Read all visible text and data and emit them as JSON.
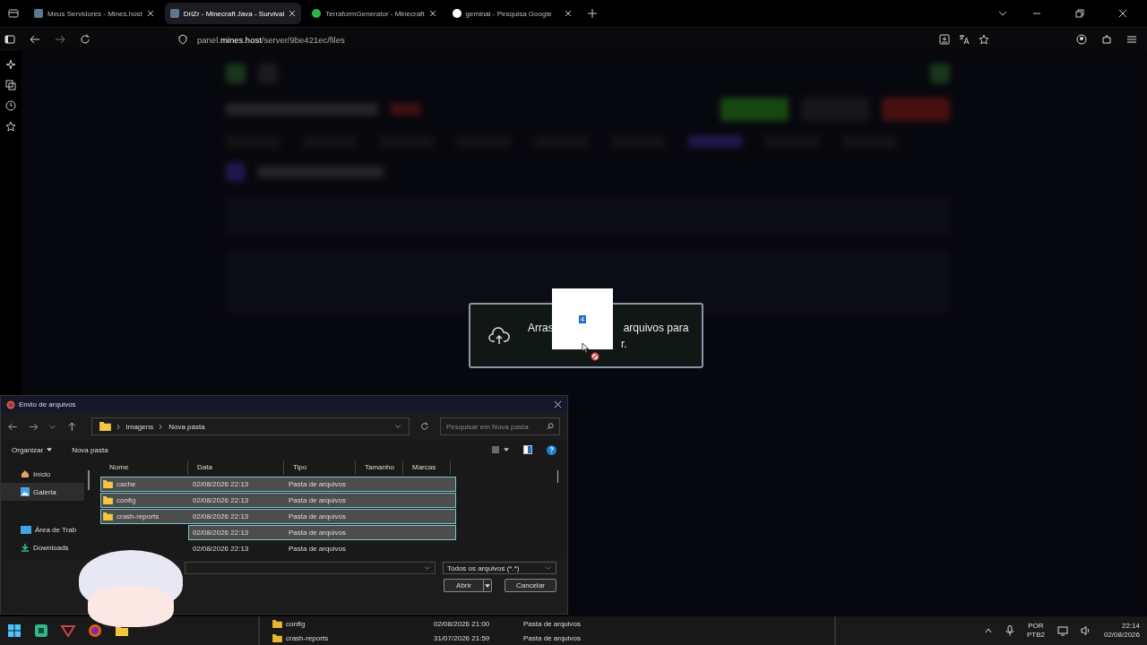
{
  "browser": {
    "tabs": [
      {
        "title": "Meus Servidores - Mines.host",
        "selected": false,
        "kind": "server"
      },
      {
        "title": "DriZr - Minecraft Java - Survival",
        "selected": true,
        "kind": "server"
      },
      {
        "title": "TerraformGenerator - Minecraft",
        "selected": false,
        "kind": "plugin"
      },
      {
        "title": "geminai - Pesquisa Google",
        "selected": false,
        "kind": "google"
      }
    ],
    "url": {
      "prefix": "panel.",
      "domain": "mines.host",
      "path": "/server/9be421ec/files"
    }
  },
  "drop_overlay": {
    "text_before": "Arras",
    "text_after": "arquivos para",
    "line_two": "r.",
    "drag_count": "4"
  },
  "dialog": {
    "title": "Envio de arquivos",
    "breadcrumb": [
      "Imagens",
      "Nova pasta"
    ],
    "search": {
      "placeholder": "Pesquisar em Nova pasta"
    },
    "toolbar": [
      "Organizar",
      "Nova pasta"
    ],
    "nav": [
      {
        "label": "Início",
        "selected": false,
        "kind": "home"
      },
      {
        "label": "Galeria",
        "selected": true,
        "kind": "gallery"
      },
      {
        "label": "Área de Trab",
        "selected": false,
        "kind": "desktop"
      },
      {
        "label": "Downloads",
        "selected": false,
        "kind": "download"
      }
    ],
    "columns": [
      "Nome",
      "Data",
      "Tipo",
      "Tamanho",
      "Marcas"
    ],
    "rows": [
      {
        "name": "cache",
        "date": "02/08/2026 22:13",
        "type": "Pasta de arquivos",
        "selected": true
      },
      {
        "name": "config",
        "date": "02/08/2026 22:13",
        "type": "Pasta de arquivos",
        "selected": true
      },
      {
        "name": "crash-reports",
        "date": "02/08/2026 22:13",
        "type": "Pasta de arquivos",
        "selected": true
      },
      {
        "date": "02/08/2026 22:13",
        "type": "Pasta de arquivos",
        "selected": true
      },
      {
        "date": "02/08/2026 22:13",
        "type": "Pasta de arquivos",
        "selected": false
      }
    ],
    "filter": "Todos os arquivos (*.*)",
    "buttons": [
      "Abrir",
      "Cancelar"
    ]
  },
  "taskbar": {
    "window_rows": [
      {
        "name": "config",
        "date": "02/08/2026 21:00",
        "type": "Pasta de arquivos"
      },
      {
        "name": "crash-reports",
        "date": "31/07/2026 21:59",
        "type": "Pasta de arquivos"
      }
    ],
    "language": [
      "POR",
      "PTB2"
    ],
    "time": "22:14",
    "date": "02/08/2026"
  }
}
